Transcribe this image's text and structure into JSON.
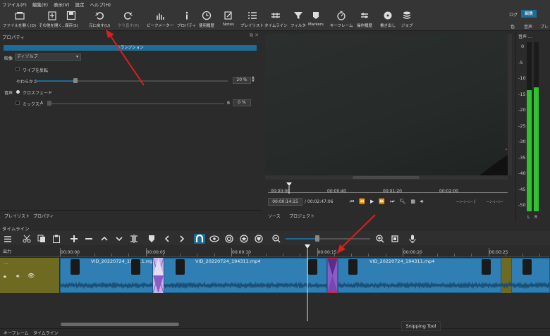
{
  "menu": [
    "ファイル(F)",
    "編集(E)",
    "表示(V)",
    "設定",
    "ヘルプ(H)"
  ],
  "toolbar": {
    "open": "ファイルを開く(O)",
    "open_other": "その他を開く...",
    "save": "保存(S)",
    "undo": "元に戻す(U)",
    "redo": "やり直す(R)",
    "peak_meter": "ピークメーター",
    "properties": "プロパティ",
    "history": "使用履歴",
    "notes": "Notes",
    "playlist": "プレイリスト",
    "timeline": "タイムライン",
    "filter": "フィルタ",
    "markers": "Markers",
    "keyframes": "キーフレーム",
    "history_ops": "操作履歴",
    "export": "書き出し",
    "jobs": "ジョブ"
  },
  "layouts": {
    "log": "ログ",
    "edit": "編集",
    "color": "色",
    "audio": "音声",
    "player": "プレー"
  },
  "properties_panel": {
    "title": "プロパティ",
    "header": "トランジション",
    "video_label": "映像",
    "video_select": "ディゾルブ",
    "wipe_invert": "ワイプを反転",
    "softness_label": "やわらかさ",
    "softness_value": "20 %",
    "audio_label": "音声",
    "crossfade": "クロスフェード",
    "mix_label": "ミックス:",
    "mix_a": "A",
    "mix_b": "B",
    "mix_value": "0 %",
    "tab_playlist": "プレイリスト",
    "tab_properties": "プロパティ"
  },
  "player": {
    "ruler": [
      "00:00:00",
      "00:00:40",
      "00:01:20",
      "00:02:00"
    ],
    "position": "00:00:14:15",
    "duration": "/ 00:02:47:06",
    "in_point": "--:--:--:-- /",
    "out_point": "--:--:--:--",
    "tab_source": "ソース",
    "tab_project": "プロジェクト"
  },
  "audio_meter": {
    "title": "音声 ...",
    "scale": [
      "0",
      "-5",
      "-10",
      "-15",
      "-20",
      "-25",
      "-30",
      "-35",
      "-40",
      "-45",
      "-50"
    ],
    "left_label": "L",
    "right_label": "R",
    "left_level_db": -14,
    "right_level_db": -13
  },
  "timeline": {
    "title": "タイムライン",
    "track_name": "出力",
    "track_dots": "...",
    "ruler": [
      "00:00:00",
      "00:00:05",
      "00:00:10",
      "00:00:15",
      "00:00:20",
      "00:00:25"
    ],
    "clip_names": [
      "VID_20220724_194311.mp4",
      "VID_20220724_194311.mp4",
      "VID_20220724_194311.mp4"
    ],
    "tab_keyframes": "キーフレーム",
    "tab_timeline": "タイムライン"
  },
  "tooltip": "Snipping Tool",
  "colors": {
    "accent": "#1e6b94",
    "clip": "#2f7fb4",
    "transition": "#8d5bc8",
    "annotation": "#e01e1e",
    "meter_green": "#2fc42f"
  }
}
